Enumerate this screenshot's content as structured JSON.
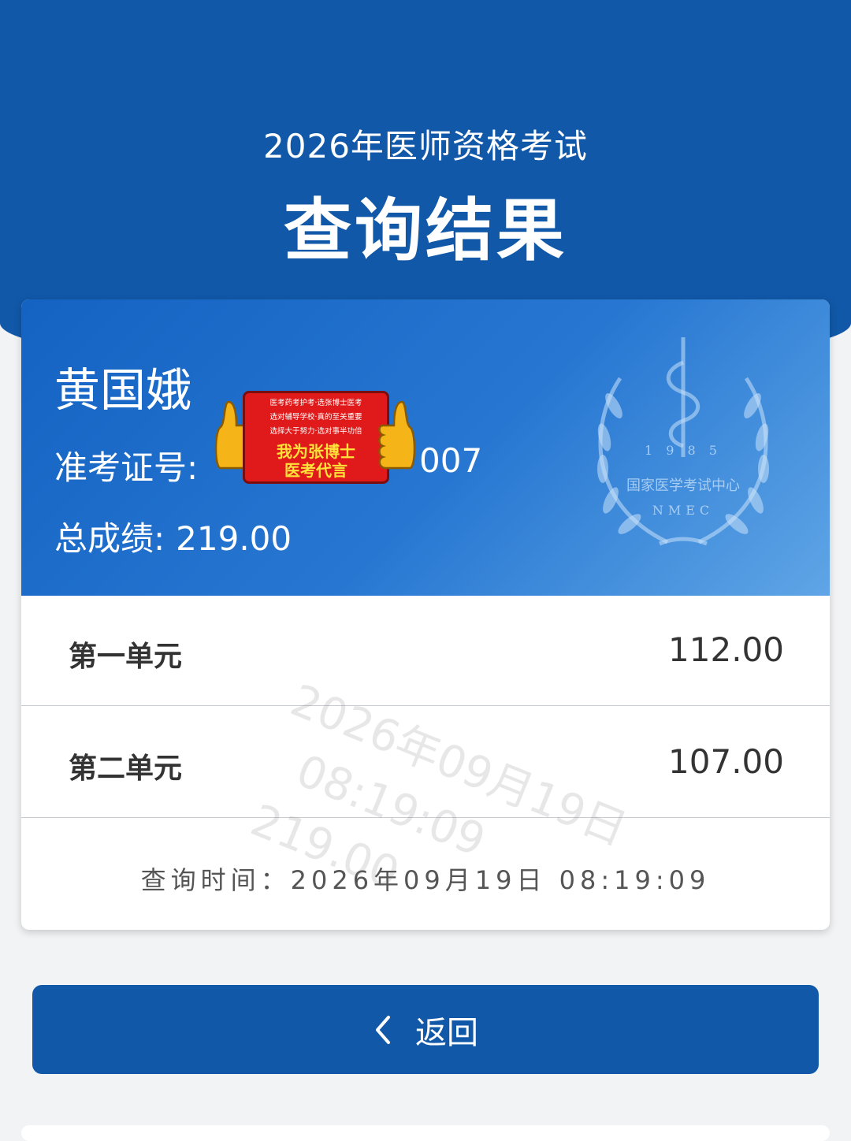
{
  "header": {
    "subtitle": "2026年医师资格考试",
    "title": "查询结果"
  },
  "candidate": {
    "name": "黄国娥",
    "id_label": "准考证号:",
    "id_visible_suffix": "007",
    "total_label": "总成绩:",
    "total_value": "219.00"
  },
  "emblem": {
    "year": "1 9 8 5",
    "org": "国家医学考试中心",
    "abbr": "NMEC"
  },
  "sticker": {
    "line1": "医考药考护考·选张博士医考",
    "line2": "选对辅导学校·真的至关重要",
    "line3": "选择大于努力·选对事半功倍",
    "big1": "我为张博士",
    "big2": "医考代言"
  },
  "units": [
    {
      "label": "第一单元",
      "score": "112.00"
    },
    {
      "label": "第二单元",
      "score": "107.00"
    }
  ],
  "query_time": {
    "label": "查询时间：",
    "value": "2026年09月19日 08:19:09"
  },
  "watermark": {
    "line1": "2026年09月19日",
    "line2": "08:19:09",
    "line3": "219.00"
  },
  "back_button": {
    "label": "返回",
    "icon": "chevron-left-icon"
  },
  "colors": {
    "primary": "#1158a8",
    "card_gradient_start": "#1462c2",
    "card_gradient_end": "#5fa5e6",
    "background": "#f2f3f5"
  }
}
